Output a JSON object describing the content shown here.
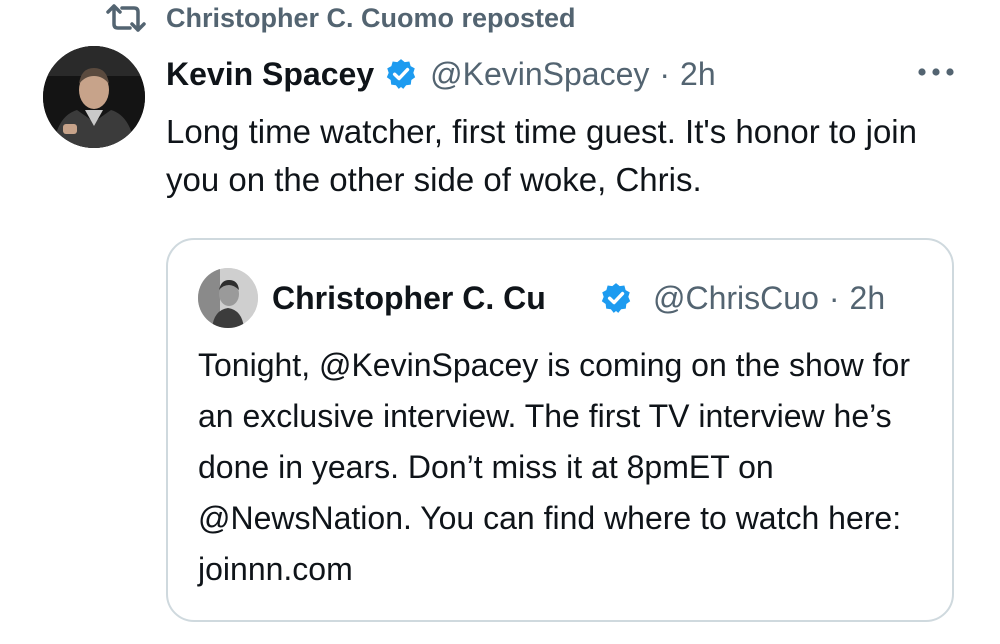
{
  "repost": {
    "label": "Christopher C. Cuomo reposted",
    "icon": "repost-icon"
  },
  "tweet": {
    "display_name": "Kevin Spacey",
    "verified_icon": "verified-badge-icon",
    "handle": "@KevinSpacey",
    "separator": "·",
    "time": "2h",
    "more_icon": "more-options-icon",
    "text": "Long time watcher, first time guest. It's honor to join you on the other side of woke, Chris."
  },
  "quote": {
    "display_name": "Christopher C. Cu",
    "verified_icon": "verified-badge-icon",
    "handle": "@ChrisCuo",
    "separator": "·",
    "time": "2h",
    "text": "Tonight, @KevinSpacey is coming on the show for an exclusive interview. The first TV interview he’s done in years. Don’t miss it at 8pmET on @NewsNation. You can find where to watch here: joinnn.com"
  },
  "colors": {
    "primary_text": "#0f1419",
    "secondary_text": "#536471",
    "verified_blue": "#1d9bf0",
    "border": "#cfd9de"
  }
}
